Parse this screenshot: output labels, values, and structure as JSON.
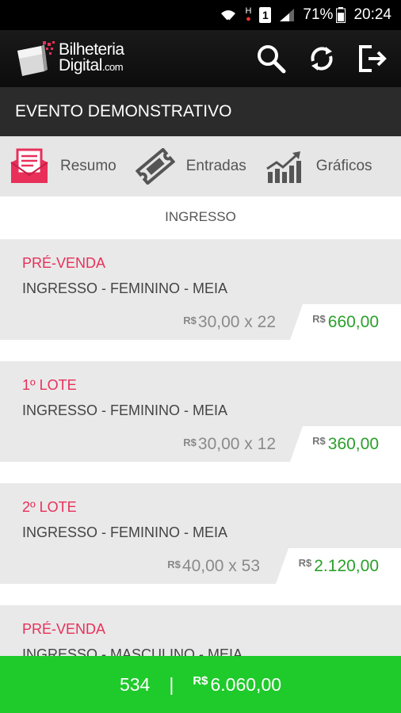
{
  "status_bar": {
    "battery": "71%",
    "time": "20:24",
    "sim_slot": "1",
    "network_letter": "H"
  },
  "app": {
    "logo_line1": "Bilheteria",
    "logo_line2": "Digital",
    "logo_suffix": ".com",
    "actions": [
      "search-icon",
      "refresh-icon",
      "logout-icon"
    ]
  },
  "event_title": "EVENTO DEMONSTRATIVO",
  "tabs": [
    {
      "label": "Resumo",
      "icon": "receipt-icon"
    },
    {
      "label": "Entradas",
      "icon": "ticket-icon"
    },
    {
      "label": "Gráficos",
      "icon": "bar-chart-icon"
    }
  ],
  "section_title": "INGRESSO",
  "currency": "R$",
  "tickets": [
    {
      "batch": "PRÉ-VENDA",
      "desc": "INGRESSO - FEMININO - MEIA",
      "price": "30,00",
      "qty": "22",
      "total": "660,00"
    },
    {
      "batch": "1º LOTE",
      "desc": "INGRESSO - FEMININO - MEIA",
      "price": "30,00",
      "qty": "12",
      "total": "360,00"
    },
    {
      "batch": "2º LOTE",
      "desc": "INGRESSO - FEMININO - MEIA",
      "price": "40,00",
      "qty": "53",
      "total": "2.120,00"
    },
    {
      "batch": "PRÉ-VENDA",
      "desc": "INGRESSO - MASCULINO - MEIA",
      "price": "",
      "qty": "",
      "total": ""
    }
  ],
  "multiply_sign": "x",
  "footer": {
    "count": "534",
    "separator": "|",
    "total": "6.060,00"
  },
  "colors": {
    "accent_red": "#e8305a",
    "total_green": "#2aa02a",
    "footer_green": "#1fca2b"
  }
}
